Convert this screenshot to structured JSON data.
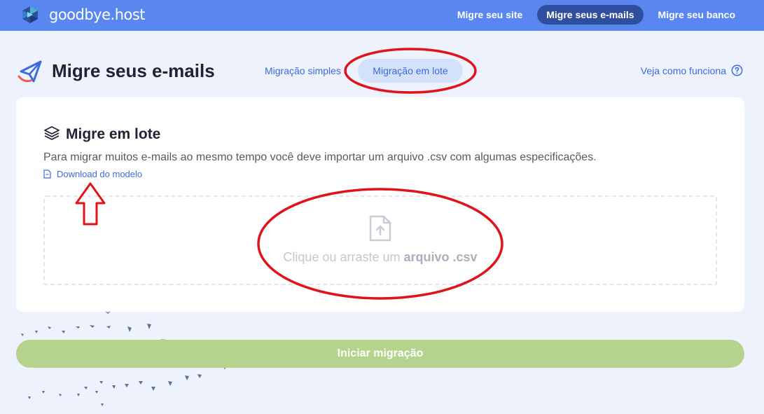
{
  "brand": {
    "name": "goodbye.host"
  },
  "nav": {
    "items": [
      {
        "label": "Migre seu site",
        "active": false
      },
      {
        "label": "Migre seus e-mails",
        "active": true
      },
      {
        "label": "Migre seu banco",
        "active": false
      }
    ]
  },
  "header": {
    "title": "Migre seus e-mails",
    "tabs": [
      {
        "label": "Migração simples",
        "active": false
      },
      {
        "label": "Migração em lote",
        "active": true
      }
    ],
    "help_label": "Veja como funciona"
  },
  "card": {
    "title": "Migre em lote",
    "description": "Para migrar muitos e-mails ao mesmo tempo você deve importar um arquivo .csv com algumas especificações.",
    "download_label": "Download do modelo",
    "dropzone": {
      "text": "Clique ou arraste um ",
      "emphasis": "arquivo .csv"
    }
  },
  "start_button": {
    "label": "Iniciar migração"
  },
  "icons": {
    "logo": "logo-icon",
    "plane": "paper-plane-icon",
    "help": "question-circle-icon",
    "layers": "layers-icon",
    "file": "file-outline-icon",
    "upload": "file-upload-icon"
  },
  "colors": {
    "nav_bg": "#5a86f0",
    "nav_active": "#2f4f9e",
    "accent": "#3c6ae0",
    "tab_active_bg": "#d3e1fb",
    "page_bg": "#eef2fc",
    "start_button": "#b5d38c",
    "annotation": "#e0131b"
  }
}
